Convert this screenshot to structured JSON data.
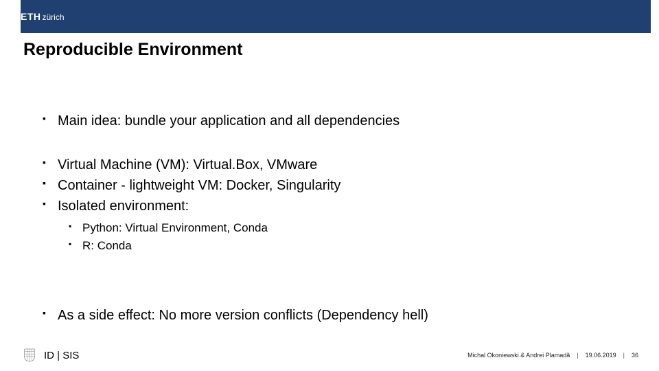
{
  "header": {
    "logo_bold": "ETH",
    "logo_thin": "zürich"
  },
  "title": "Reproducible Environment",
  "bullets": {
    "b1": "Main idea: bundle your application and all dependencies",
    "b2": "Virtual Machine (VM): Virtual.Box, VMware",
    "b3": "Container - lightweight VM: Docker, Singularity",
    "b4": "Isolated environment:",
    "b4a": "Python: Virtual Environment, Conda",
    "b4b": "R: Conda",
    "b5": "As a side effect: No more version conflicts (Dependency hell)"
  },
  "footer": {
    "dept": "ID | SIS",
    "authors": "Michal Okoniewski & Andrei Plamadă",
    "date": "19.06.2019",
    "page": "36"
  }
}
